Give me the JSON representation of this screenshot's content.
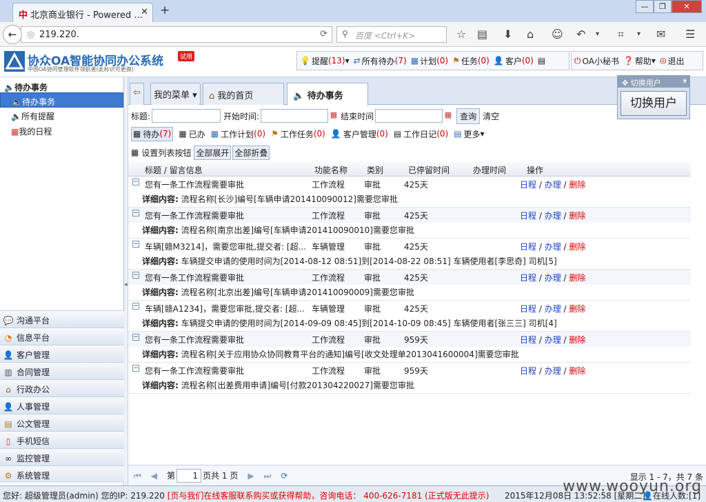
{
  "browser": {
    "tab_title": "北京商业银行 - Powered ...",
    "url": "219.220.",
    "search_placeholder": "百度 <Ctrl+K>"
  },
  "app": {
    "brand": "协众OA智能协同办公系统",
    "brand_sub": "中国OA协同管理软件领航者(此标识可更换)",
    "trial_badge": "试用"
  },
  "toolbar": {
    "remind_label": "提醒",
    "remind_count": "(13)",
    "pending_label": "所有待办",
    "pending_count": "(7)",
    "plan_label": "计划",
    "plan_count": "(0)",
    "task_label": "任务",
    "task_count": "(0)",
    "customer_label": "客户",
    "customer_count": "(0)",
    "secretary_label": "OA小秘书",
    "help_label": "帮助",
    "exit_label": "退出"
  },
  "sidebar": {
    "header": "待办事务",
    "items": [
      {
        "label": "待办事务"
      },
      {
        "label": "所有提醒"
      },
      {
        "label": "我的日程"
      }
    ],
    "modules": [
      {
        "label": "沟通平台"
      },
      {
        "label": "信息平台"
      },
      {
        "label": "客户管理"
      },
      {
        "label": "合同管理"
      },
      {
        "label": "行政办公"
      },
      {
        "label": "人事管理"
      },
      {
        "label": "公文管理"
      },
      {
        "label": "手机短信"
      },
      {
        "label": "监控管理"
      },
      {
        "label": "系统管理"
      }
    ]
  },
  "main": {
    "tabs": {
      "menu": "我的菜单",
      "home": "我的首页",
      "todo": "待办事务"
    },
    "filter": {
      "title_label": "标题:",
      "start_label": "开始时间:",
      "end_label": "结束时间",
      "query": "查询",
      "clear": "清空"
    },
    "subtabs": {
      "todo": "待办",
      "todo_count": "(7)",
      "done": "已办",
      "plan": "工作计划",
      "plan_count": "(0)",
      "task": "工作任务",
      "task_count": "(0)",
      "cust": "客户管理",
      "cust_count": "(0)",
      "diary": "工作日记",
      "diary_count": "(0)",
      "more": "更多"
    },
    "listbtns": {
      "set": "设置列表按钮",
      "expand": "全部展开",
      "collapse": "全部折叠"
    },
    "columns": [
      "标题 / 留言信息",
      "功能名称",
      "类别",
      "已停留时间",
      "办理时间",
      "操作"
    ],
    "rows": [
      {
        "title": "您有一条工作流程需要审批",
        "func": "工作流程",
        "cat": "审批",
        "stay": "425天",
        "detail": "流程名称[长沙]编号[车辆申请201410090012]需要您审批"
      },
      {
        "title": "您有一条工作流程需要审批",
        "func": "工作流程",
        "cat": "审批",
        "stay": "425天",
        "detail": "流程名称[南京出差]编号[车辆申请201410090010]需要您审批"
      },
      {
        "title": "车辆[赣M3214]，需要您审批,提交者: [超...",
        "func": "车辆管理",
        "cat": "审批",
        "stay": "425天",
        "detail": "车辆提交申请的使用时间为[2014-08-12 08:51]到[2014-08-22 08:51] 车辆使用者[李思奇] 司机[5]"
      },
      {
        "title": "您有一条工作流程需要审批",
        "func": "工作流程",
        "cat": "审批",
        "stay": "425天",
        "detail": "流程名称[北京出差]编号[车辆申请201410090009]需要您审批"
      },
      {
        "title": "车辆[赣A1234]，需要您审批,提交者: [超...",
        "func": "车辆管理",
        "cat": "审批",
        "stay": "425天",
        "detail": "车辆提交申请的使用时间为[2014-09-09 08:45]到[2014-10-09 08:45] 车辆使用者[张三三] 司机[4]"
      },
      {
        "title": "您有一条工作流程需要审批",
        "func": "工作流程",
        "cat": "审批",
        "stay": "959天",
        "detail": "流程名称[关于应用协众协同教育平台的通知]编号[收文处理单2013041600004]需要您审批"
      },
      {
        "title": "您有一条工作流程需要审批",
        "func": "工作流程",
        "cat": "审批",
        "stay": "959天",
        "detail": "流程名称[出差费用申请]编号[付款201304220027]需要您审批"
      }
    ],
    "detail_label": "详细内容:",
    "ops": {
      "schedule": "日程",
      "handle": "办理",
      "delete": "删除",
      "sep": " / "
    },
    "pager": {
      "page_prefix": "第",
      "page": "1",
      "page_suffix": "页共 1 页",
      "display": "显示 1 - 7，共 7 条"
    }
  },
  "switch_user": {
    "title": "切换用户",
    "button": "切换用户"
  },
  "status": {
    "user": "您好: 超级管理员(admin) 您的IP: 219.220",
    "notice": "[页与我们在线客服联系购买或获得帮助，咨询电话： 400-626-7181 (正式版无此提示)",
    "datetime": "2015年12月08日 13:52:58 [星期二]",
    "online": "在线人数:[1]",
    "watermark": "www.wooyun.org"
  }
}
